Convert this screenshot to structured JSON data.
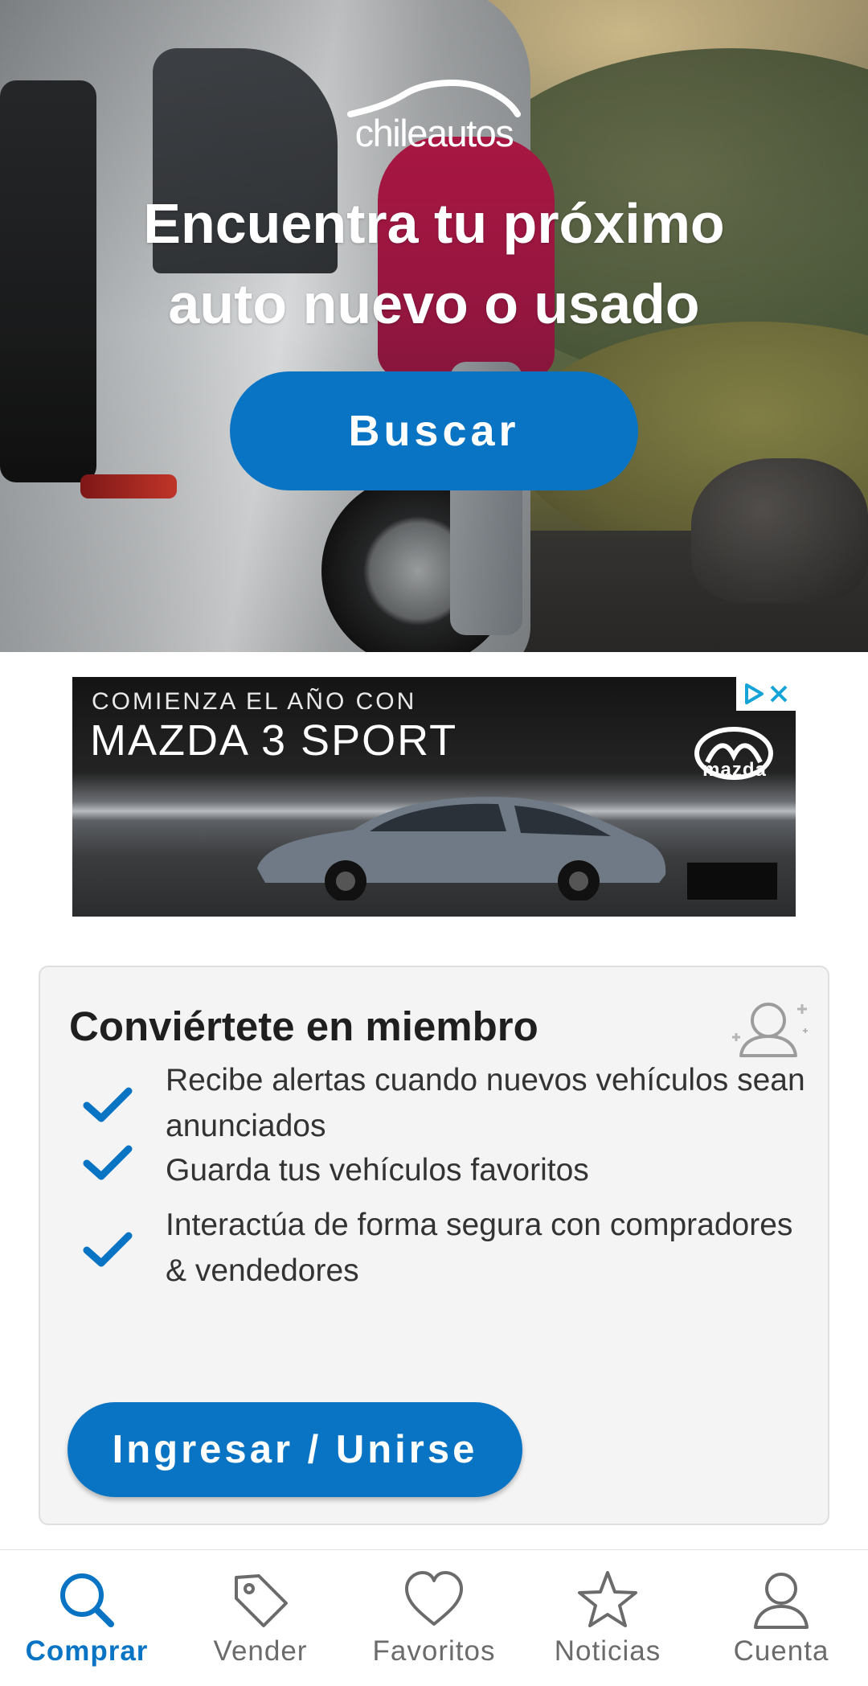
{
  "hero": {
    "logo_text": "chileautos",
    "title_line1": "Encuentra tu próximo",
    "title_line2": "auto nuevo o usado",
    "search_label": "Buscar"
  },
  "ad": {
    "line1": "COMIENZA EL AÑO CON",
    "line2": "MAZDA 3 SPORT",
    "brand": "mazda",
    "adchoices_icon": "adchoices-icon",
    "close_icon": "close-icon"
  },
  "member": {
    "title": "Conviértete en miembro",
    "benefits": [
      "Recibe alertas cuando nuevos vehículos sean anunciados",
      "Guarda tus vehículos favoritos",
      "Interactúa de forma segura con compradores & vendedores"
    ],
    "join_label": "Ingresar / Unirse"
  },
  "nav": {
    "items": [
      {
        "label": "Comprar",
        "icon": "search-icon",
        "active": true
      },
      {
        "label": "Vender",
        "icon": "tag-icon",
        "active": false
      },
      {
        "label": "Favoritos",
        "icon": "heart-icon",
        "active": false
      },
      {
        "label": "Noticias",
        "icon": "star-icon",
        "active": false
      },
      {
        "label": "Cuenta",
        "icon": "user-icon",
        "active": false
      }
    ]
  },
  "colors": {
    "accent": "#0a74c4",
    "inactive": "#6b6b6b"
  }
}
